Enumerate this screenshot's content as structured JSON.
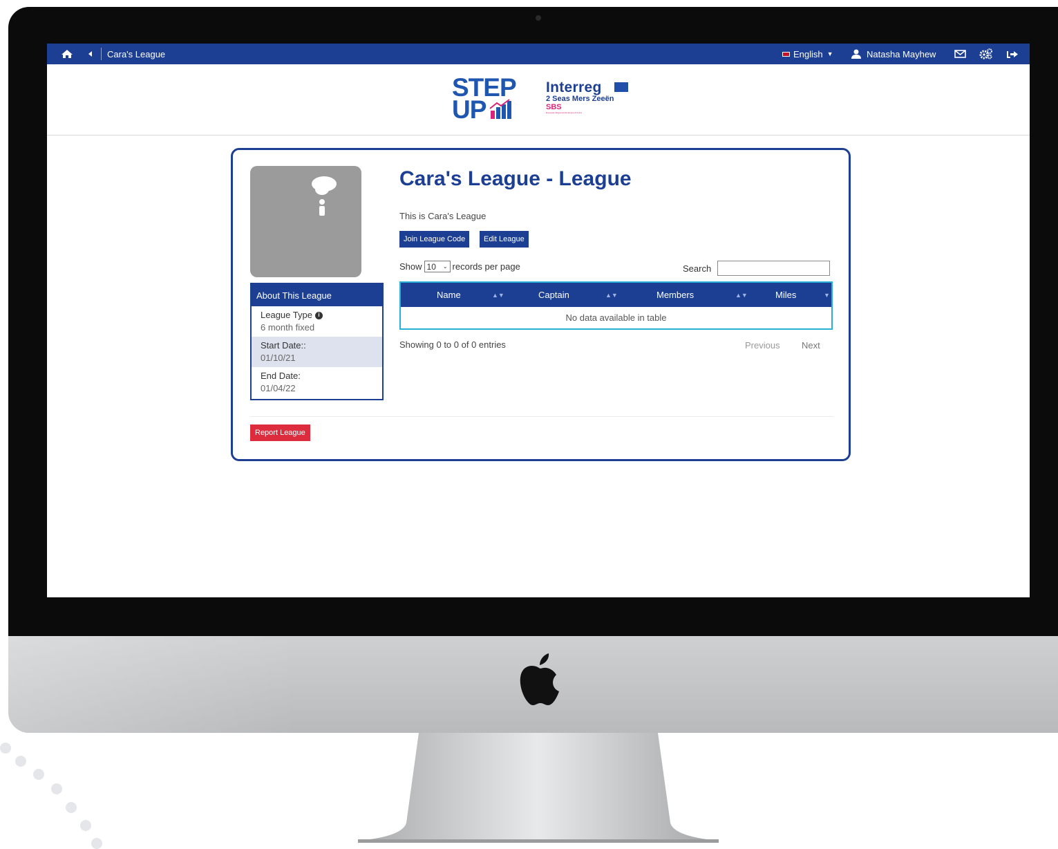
{
  "topbar": {
    "breadcrumb": "Cara's League",
    "language": "English",
    "user_name": "Natasha Mayhew"
  },
  "branding": {
    "step_line1": "STEP",
    "step_line2": "UP",
    "interreg_name": "Interreg",
    "interreg_sub": "2 Seas Mers Zeeën",
    "interreg_program": "SBS",
    "interreg_fund": "European Regional Development Fund"
  },
  "league": {
    "title": "Cara's League - League",
    "description": "This is Cara's League",
    "join_button": "Join League Code",
    "edit_button": "Edit League",
    "report_button": "Report League"
  },
  "about": {
    "heading": "About This League",
    "rows": [
      {
        "label": "League Type",
        "value": "6 month fixed"
      },
      {
        "label": "Start Date::",
        "value": "01/10/21"
      },
      {
        "label": "End Date:",
        "value": "01/04/22"
      }
    ]
  },
  "table_controls": {
    "show_label": "Show",
    "per_page_value": "10",
    "per_page_suffix": "records per page",
    "search_label": "Search"
  },
  "table": {
    "columns": [
      "Name",
      "Captain",
      "Members",
      "Miles"
    ],
    "empty_message": "No data available in table",
    "info": "Showing 0 to 0 of 0 entries",
    "previous": "Previous",
    "next": "Next"
  },
  "colors": {
    "primary": "#1c3f93",
    "accent_border": "#28b0d6",
    "danger": "#dc2c3e"
  },
  "icons": [
    "home-icon",
    "back-icon",
    "uk-flag-icon",
    "user-icon",
    "envelope-icon",
    "cogs-icon",
    "sign-out-icon",
    "info-icon",
    "apple-logo-icon"
  ]
}
